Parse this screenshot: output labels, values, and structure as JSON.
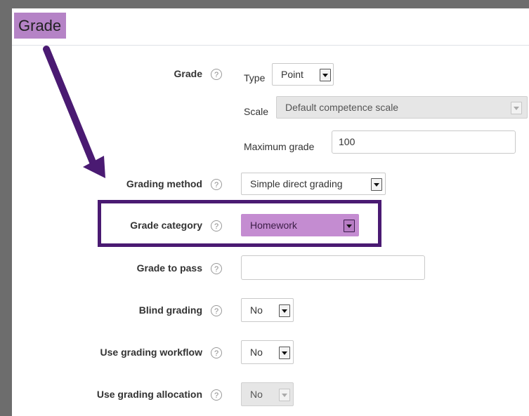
{
  "section": {
    "title": "Grade"
  },
  "grade": {
    "label": "Grade",
    "type_label": "Type",
    "type_value": "Point",
    "scale_label": "Scale",
    "scale_value": "Default competence scale",
    "max_label": "Maximum grade",
    "max_value": "100"
  },
  "grading_method": {
    "label": "Grading method",
    "value": "Simple direct grading"
  },
  "grade_category": {
    "label": "Grade category",
    "value": "Homework"
  },
  "grade_to_pass": {
    "label": "Grade to pass",
    "value": ""
  },
  "blind_grading": {
    "label": "Blind grading",
    "value": "No"
  },
  "grading_workflow": {
    "label": "Use grading workflow",
    "value": "No"
  },
  "grading_allocation": {
    "label": "Use grading allocation",
    "value": "No"
  },
  "help_glyph": "?",
  "colors": {
    "title_highlight": "#b583c6",
    "select_highlight": "#c48cd1",
    "annotation": "#4a1a72",
    "background": "#6d6d6d"
  },
  "icons": [
    "help-icon",
    "dropdown-arrow-icon",
    "annotation-arrow"
  ]
}
